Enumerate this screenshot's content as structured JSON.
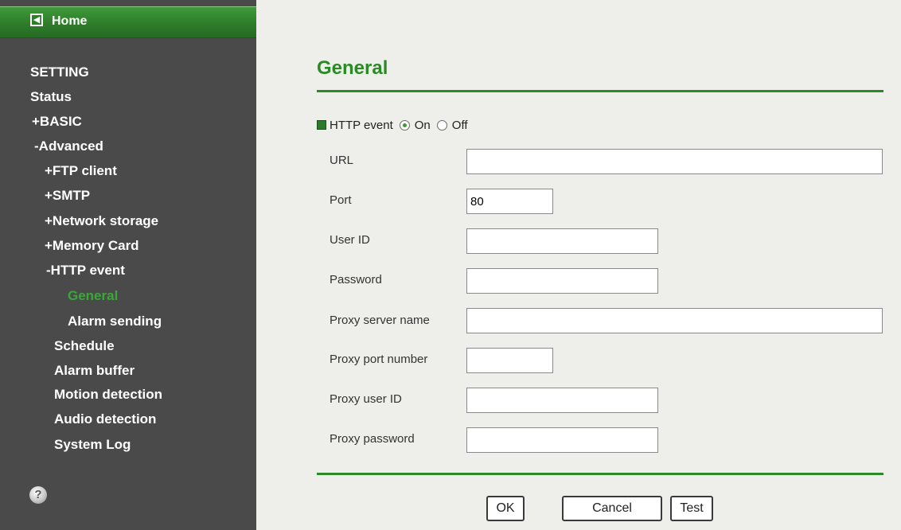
{
  "sidebar": {
    "home_label": "Home",
    "home_icon": "back-arrow-icon",
    "items": [
      {
        "label": "SETTING"
      },
      {
        "label": "Status"
      },
      {
        "label": "+BASIC"
      },
      {
        "label": "-Advanced"
      },
      {
        "label": "+FTP client"
      },
      {
        "label": "+SMTP"
      },
      {
        "label": "+Network storage"
      },
      {
        "label": "+Memory Card"
      },
      {
        "label": "-HTTP event"
      },
      {
        "label": "General",
        "active": true
      },
      {
        "label": "Alarm sending"
      },
      {
        "label": "Schedule"
      },
      {
        "label": "Alarm buffer"
      },
      {
        "label": "Motion detection"
      },
      {
        "label": "Audio detection"
      },
      {
        "label": "System Log"
      }
    ],
    "help_icon": "help-icon"
  },
  "main": {
    "title": "General",
    "http_event": {
      "label": "HTTP event",
      "on_label": "On",
      "off_label": "Off",
      "selected": "On"
    },
    "fields": {
      "url": {
        "label": "URL",
        "value": ""
      },
      "port": {
        "label": "Port",
        "value": "80"
      },
      "user_id": {
        "label": "User ID",
        "value": ""
      },
      "password": {
        "label": "Password",
        "value": ""
      },
      "proxy_server_name": {
        "label": "Proxy server name",
        "value": ""
      },
      "proxy_port_number": {
        "label": "Proxy port number",
        "value": ""
      },
      "proxy_user_id": {
        "label": "Proxy user ID",
        "value": ""
      },
      "proxy_password": {
        "label": "Proxy password",
        "value": ""
      }
    },
    "buttons": {
      "ok": "OK",
      "cancel": "Cancel",
      "test": "Test"
    }
  },
  "colors": {
    "accent_green": "#2b8a26",
    "sidebar_bg": "#4a4a4a",
    "panel_bg": "#eeeeea"
  }
}
